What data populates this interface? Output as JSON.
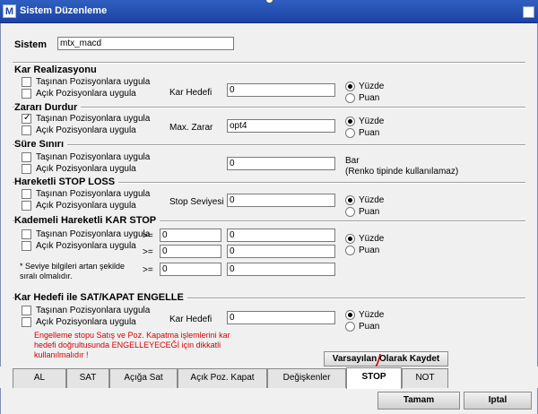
{
  "window": {
    "icon_letter": "M",
    "title": "Sistem Düzenleme"
  },
  "sistem": {
    "label": "Sistem",
    "value": "mtx_macd"
  },
  "kar_realizasyonu": {
    "title": "Kar Realizasyonu",
    "opt_tasinan": "Taşınan Pozisyonlara uygula",
    "opt_acik": "Açık Pozisyonlara uygula",
    "field_label": "Kar Hedefi",
    "field_value": "0",
    "radio_yuzde": "Yüzde",
    "radio_puan": "Puan"
  },
  "zarari_durdur": {
    "title": "Zararı Durdur",
    "opt_tasinan": "Taşınan Pozisyonlara uygula",
    "opt_acik": "Açık Pozisyonlara uygula",
    "field_label": "Max. Zarar",
    "field_value": "opt4",
    "radio_yuzde": "Yüzde",
    "radio_puan": "Puan"
  },
  "sure_siniri": {
    "title": "Süre Sınırı",
    "opt_tasinan": "Taşınan Pozisyonlara uygula",
    "opt_acik": "Açık Pozisyonlara uygula",
    "field_value": "0",
    "unit": "Bar",
    "unit_note": "(Renko tipinde kullanılamaz)"
  },
  "hareketli_stop": {
    "title": "Hareketli STOP LOSS",
    "opt_tasinan": "Taşınan Pozisyonlara uygula",
    "opt_acik": "Açık Pozisyonlara uygula",
    "field_label": "Stop Seviyesi",
    "field_value": "0",
    "radio_yuzde": "Yüzde",
    "radio_puan": "Puan"
  },
  "kademeli": {
    "title": "Kademeli Hareketli KAR STOP",
    "opt_tasinan": "Taşınan Pozisyonlara uygula",
    "opt_acik": "Açık Pozisyonlara uygula",
    "ge": ">=",
    "row1_a": "0",
    "row1_b": "0",
    "row2_a": "0",
    "row2_b": "0",
    "row3_a": "0",
    "row3_b": "0",
    "note": "* Seviye bilgileri artan şekilde sıralı olmalıdır.",
    "radio_yuzde": "Yüzde",
    "radio_puan": "Puan"
  },
  "kar_hedefi_engelle": {
    "title": "Kar Hedefi ile SAT/KAPAT ENGELLE",
    "opt_tasinan": "Taşınan Pozisyonlara uygula",
    "opt_acik": "Açık Pozisyonlara uygula",
    "field_label": "Kar Hedefi",
    "field_value": "0",
    "radio_yuzde": "Yüzde",
    "radio_puan": "Puan",
    "warning": "Engelleme stopu Satış ve Poz. Kapatma işlemlerini kar hedefi doğrultusunda ENGELLEYECEĞİ için dikkatli kullanılmalıdır !"
  },
  "buttons": {
    "save_default": "Varsayılan Olarak Kaydet",
    "ok": "Tamam",
    "cancel": "Iptal"
  },
  "tabs": [
    "AL",
    "SAT",
    "Açığa Sat",
    "Açık Poz. Kapat",
    "Değişkenler",
    "STOP",
    "NOT"
  ],
  "colors": {
    "titlebar": "#1c43a3",
    "warning": "#d40000",
    "annotation": "#d40000"
  }
}
